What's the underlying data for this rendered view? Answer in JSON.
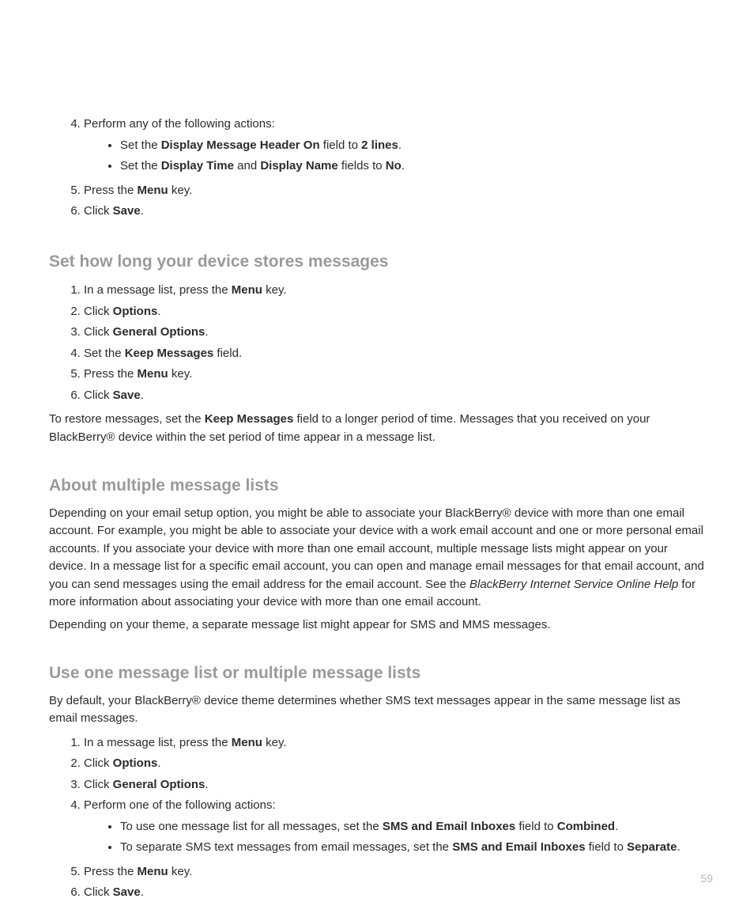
{
  "pageNumber": "59",
  "section1": {
    "heading": "Set how long your device stores messages",
    "step1_prefix": "In a message list, press the ",
    "step1_bold": "Menu",
    "step1_suffix": " key.",
    "step2_prefix": "Click ",
    "step2_bold": "Options",
    "step2_suffix": ".",
    "step3_prefix": "Click ",
    "step3_bold": "General Options",
    "step3_suffix": ".",
    "step4_prefix": "Set the ",
    "step4_bold": "Keep Messages",
    "step4_suffix": " field.",
    "step5_prefix": "Press the ",
    "step5_bold": "Menu",
    "step5_suffix": " key.",
    "step6_prefix": "Click ",
    "step6_bold": "Save",
    "step6_suffix": ".",
    "restore_prefix": "To restore messages, set the ",
    "restore_bold": "Keep Messages",
    "restore_suffix": " field to a longer period of time. Messages that you received on your BlackBerry® device within the set period of time appear in a message list."
  },
  "topList": {
    "step4_text": "Perform any of the following actions:",
    "bullet1_a": "Set the ",
    "bullet1_b": "Display Message Header On",
    "bullet1_c": " field to ",
    "bullet1_d": "2 lines",
    "bullet1_e": ".",
    "bullet2_a": "Set the ",
    "bullet2_b": "Display Time",
    "bullet2_c": " and ",
    "bullet2_d": "Display Name",
    "bullet2_e": " fields to ",
    "bullet2_f": "No",
    "bullet2_g": ".",
    "step5_prefix": "Press the ",
    "step5_bold": "Menu",
    "step5_suffix": " key.",
    "step6_prefix": "Click ",
    "step6_bold": "Save",
    "step6_suffix": "."
  },
  "section2": {
    "heading": "About multiple message lists",
    "para1_a": "Depending on your email setup option, you might be able to associate your BlackBerry® device with more than one email account. For example, you might be able to associate your device with a work email account and one or more personal email accounts. If you associate your device with more than one email account, multiple message lists might appear on your device. In a message list for a specific email account, you can open and manage email messages for that email account, and you can send messages using the email address for the email account. See the ",
    "para1_italic": " BlackBerry Internet Service Online Help",
    "para1_b": " for more information about associating your device with more than one email account.",
    "para2": "Depending on your theme, a separate message list might appear for SMS and MMS messages."
  },
  "section3": {
    "heading": "Use one message list or multiple message lists",
    "intro": "By default, your BlackBerry® device theme determines whether SMS text messages appear in the same message list as email messages.",
    "step1_prefix": "In a message list, press the ",
    "step1_bold": "Menu",
    "step1_suffix": " key.",
    "step2_prefix": "Click ",
    "step2_bold": "Options",
    "step2_suffix": ".",
    "step3_prefix": "Click ",
    "step3_bold": "General Options",
    "step3_suffix": ".",
    "step4_text": "Perform one of the following actions:",
    "bullet1_a": "To use one message list for all messages, set the ",
    "bullet1_b": "SMS and Email Inboxes",
    "bullet1_c": " field to ",
    "bullet1_d": "Combined",
    "bullet1_e": ".",
    "bullet2_a": "To separate SMS text messages from email messages, set the ",
    "bullet2_b": "SMS and Email Inboxes",
    "bullet2_c": " field to ",
    "bullet2_d": "Separate",
    "bullet2_e": ".",
    "step5_prefix": "Press the ",
    "step5_bold": "Menu",
    "step5_suffix": " key.",
    "step6_prefix": "Click ",
    "step6_bold": "Save",
    "step6_suffix": "."
  }
}
